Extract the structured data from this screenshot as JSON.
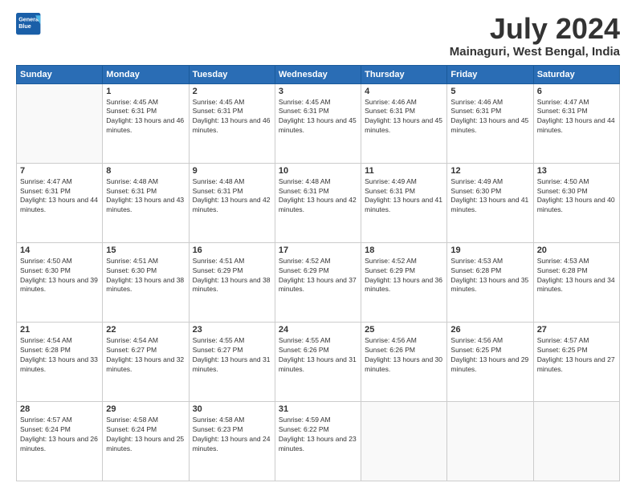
{
  "logo": {
    "line1": "General",
    "line2": "Blue"
  },
  "title": "July 2024",
  "subtitle": "Mainaguri, West Bengal, India",
  "days_of_week": [
    "Sunday",
    "Monday",
    "Tuesday",
    "Wednesday",
    "Thursday",
    "Friday",
    "Saturday"
  ],
  "weeks": [
    [
      {
        "day": "",
        "sunrise": "",
        "sunset": "",
        "daylight": ""
      },
      {
        "day": "1",
        "sunrise": "4:45 AM",
        "sunset": "6:31 PM",
        "daylight": "13 hours and 46 minutes."
      },
      {
        "day": "2",
        "sunrise": "4:45 AM",
        "sunset": "6:31 PM",
        "daylight": "13 hours and 46 minutes."
      },
      {
        "day": "3",
        "sunrise": "4:45 AM",
        "sunset": "6:31 PM",
        "daylight": "13 hours and 45 minutes."
      },
      {
        "day": "4",
        "sunrise": "4:46 AM",
        "sunset": "6:31 PM",
        "daylight": "13 hours and 45 minutes."
      },
      {
        "day": "5",
        "sunrise": "4:46 AM",
        "sunset": "6:31 PM",
        "daylight": "13 hours and 45 minutes."
      },
      {
        "day": "6",
        "sunrise": "4:47 AM",
        "sunset": "6:31 PM",
        "daylight": "13 hours and 44 minutes."
      }
    ],
    [
      {
        "day": "7",
        "sunrise": "4:47 AM",
        "sunset": "6:31 PM",
        "daylight": "13 hours and 44 minutes."
      },
      {
        "day": "8",
        "sunrise": "4:48 AM",
        "sunset": "6:31 PM",
        "daylight": "13 hours and 43 minutes."
      },
      {
        "day": "9",
        "sunrise": "4:48 AM",
        "sunset": "6:31 PM",
        "daylight": "13 hours and 42 minutes."
      },
      {
        "day": "10",
        "sunrise": "4:48 AM",
        "sunset": "6:31 PM",
        "daylight": "13 hours and 42 minutes."
      },
      {
        "day": "11",
        "sunrise": "4:49 AM",
        "sunset": "6:31 PM",
        "daylight": "13 hours and 41 minutes."
      },
      {
        "day": "12",
        "sunrise": "4:49 AM",
        "sunset": "6:30 PM",
        "daylight": "13 hours and 41 minutes."
      },
      {
        "day": "13",
        "sunrise": "4:50 AM",
        "sunset": "6:30 PM",
        "daylight": "13 hours and 40 minutes."
      }
    ],
    [
      {
        "day": "14",
        "sunrise": "4:50 AM",
        "sunset": "6:30 PM",
        "daylight": "13 hours and 39 minutes."
      },
      {
        "day": "15",
        "sunrise": "4:51 AM",
        "sunset": "6:30 PM",
        "daylight": "13 hours and 38 minutes."
      },
      {
        "day": "16",
        "sunrise": "4:51 AM",
        "sunset": "6:29 PM",
        "daylight": "13 hours and 38 minutes."
      },
      {
        "day": "17",
        "sunrise": "4:52 AM",
        "sunset": "6:29 PM",
        "daylight": "13 hours and 37 minutes."
      },
      {
        "day": "18",
        "sunrise": "4:52 AM",
        "sunset": "6:29 PM",
        "daylight": "13 hours and 36 minutes."
      },
      {
        "day": "19",
        "sunrise": "4:53 AM",
        "sunset": "6:28 PM",
        "daylight": "13 hours and 35 minutes."
      },
      {
        "day": "20",
        "sunrise": "4:53 AM",
        "sunset": "6:28 PM",
        "daylight": "13 hours and 34 minutes."
      }
    ],
    [
      {
        "day": "21",
        "sunrise": "4:54 AM",
        "sunset": "6:28 PM",
        "daylight": "13 hours and 33 minutes."
      },
      {
        "day": "22",
        "sunrise": "4:54 AM",
        "sunset": "6:27 PM",
        "daylight": "13 hours and 32 minutes."
      },
      {
        "day": "23",
        "sunrise": "4:55 AM",
        "sunset": "6:27 PM",
        "daylight": "13 hours and 31 minutes."
      },
      {
        "day": "24",
        "sunrise": "4:55 AM",
        "sunset": "6:26 PM",
        "daylight": "13 hours and 31 minutes."
      },
      {
        "day": "25",
        "sunrise": "4:56 AM",
        "sunset": "6:26 PM",
        "daylight": "13 hours and 30 minutes."
      },
      {
        "day": "26",
        "sunrise": "4:56 AM",
        "sunset": "6:25 PM",
        "daylight": "13 hours and 29 minutes."
      },
      {
        "day": "27",
        "sunrise": "4:57 AM",
        "sunset": "6:25 PM",
        "daylight": "13 hours and 27 minutes."
      }
    ],
    [
      {
        "day": "28",
        "sunrise": "4:57 AM",
        "sunset": "6:24 PM",
        "daylight": "13 hours and 26 minutes."
      },
      {
        "day": "29",
        "sunrise": "4:58 AM",
        "sunset": "6:24 PM",
        "daylight": "13 hours and 25 minutes."
      },
      {
        "day": "30",
        "sunrise": "4:58 AM",
        "sunset": "6:23 PM",
        "daylight": "13 hours and 24 minutes."
      },
      {
        "day": "31",
        "sunrise": "4:59 AM",
        "sunset": "6:22 PM",
        "daylight": "13 hours and 23 minutes."
      },
      {
        "day": "",
        "sunrise": "",
        "sunset": "",
        "daylight": ""
      },
      {
        "day": "",
        "sunrise": "",
        "sunset": "",
        "daylight": ""
      },
      {
        "day": "",
        "sunrise": "",
        "sunset": "",
        "daylight": ""
      }
    ]
  ]
}
